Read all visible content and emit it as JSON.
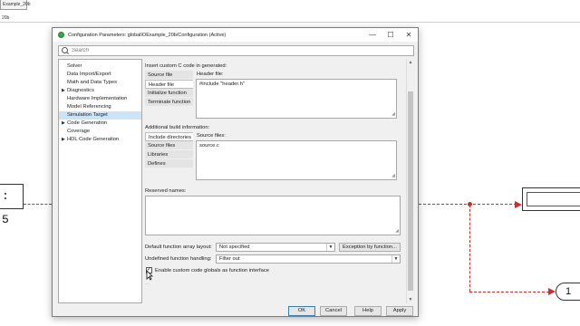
{
  "background": {
    "tab_label": "Example_20b",
    "breadcrumb": "20b",
    "left_block_text": ": 5",
    "out_port_label": "1",
    "line_color": "#d23b3b"
  },
  "dialog": {
    "title": "Configuration Parameters: globalIOExample_20b/Configuration (Active)",
    "window_controls": {
      "minimize": "—",
      "maximize": "☐",
      "close": "✕"
    },
    "search_placeholder": "Search",
    "tree": [
      {
        "label": "Solver",
        "caret": "",
        "selected": false
      },
      {
        "label": "Data Import/Export",
        "caret": "",
        "selected": false
      },
      {
        "label": "Math and Data Types",
        "caret": "",
        "selected": false
      },
      {
        "label": "Diagnostics",
        "caret": "▶",
        "selected": false
      },
      {
        "label": "Hardware Implementation",
        "caret": "",
        "selected": false
      },
      {
        "label": "Model Referencing",
        "caret": "",
        "selected": false
      },
      {
        "label": "Simulation Target",
        "caret": "",
        "selected": true
      },
      {
        "label": "Code Generation",
        "caret": "▶",
        "selected": false
      },
      {
        "label": "Coverage",
        "caret": "",
        "selected": false
      },
      {
        "label": "HDL Code Generation",
        "caret": "▶",
        "selected": false
      }
    ],
    "insert_section": {
      "heading": "Insert custom C code in generated:",
      "tabs": [
        "Source file",
        "Header file",
        "Initialize function",
        "Terminate function"
      ],
      "active_tab": 1,
      "field_label": "Header file:",
      "field_value": "#include \"header.h\""
    },
    "build_section": {
      "heading": "Additional build information:",
      "tabs": [
        "Include directories",
        "Source files",
        "Libraries",
        "Defines"
      ],
      "active_tab": 1,
      "field_label": "Source files:",
      "field_value": "source.c"
    },
    "reserved": {
      "label": "Reserved names:",
      "value": ""
    },
    "default_array_layout": {
      "label": "Default function array layout:",
      "value": "Not specified",
      "button": "Exception by function..."
    },
    "undefined_handling": {
      "label": "Undefined function handling:",
      "value": "Filter out"
    },
    "custom_globals": {
      "label": "Enable custom code globals as function interface",
      "checked": true,
      "mark": "✓"
    },
    "ellipsis": "...",
    "footer_buttons": {
      "ok": "OK",
      "cancel": "Cancel",
      "help": "Help",
      "apply": "Apply"
    }
  }
}
